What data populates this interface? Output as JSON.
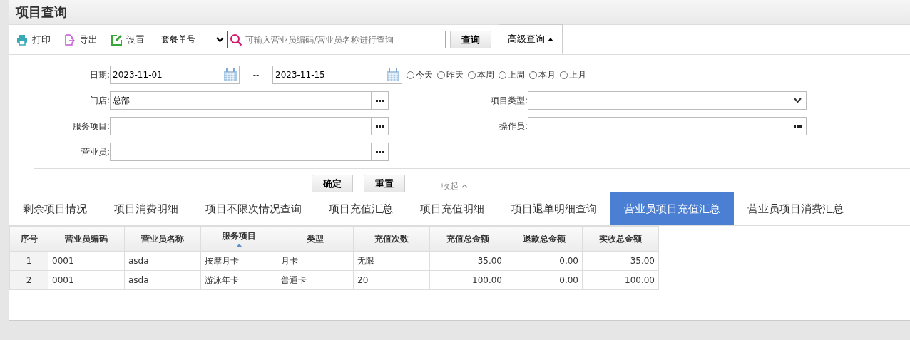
{
  "title": "项目查询",
  "toolbar": {
    "print": "打印",
    "export": "导出",
    "settings": "设置",
    "field_select": "套餐单号",
    "search_placeholder": "可输入营业员编码/营业员名称进行查询",
    "search_button": "查询",
    "advanced": "高级查询",
    "advanced_expanded": true
  },
  "form": {
    "date_label": "日期:",
    "date_from": "2023-11-01",
    "date_sep": "--",
    "date_to": "2023-11-15",
    "quick_ranges": [
      {
        "label": "今天",
        "selected": false
      },
      {
        "label": "昨天",
        "selected": false
      },
      {
        "label": "本周",
        "selected": false
      },
      {
        "label": "上周",
        "selected": false
      },
      {
        "label": "本月",
        "selected": false
      },
      {
        "label": "上月",
        "selected": false
      }
    ],
    "store_label": "门店:",
    "store_value": "总部",
    "type_label": "项目类型:",
    "service_label": "服务项目:",
    "operator_label": "操作员:",
    "salesperson_label": "营业员:",
    "confirm": "确定",
    "reset": "重置",
    "collapse": "收起"
  },
  "tabs": [
    {
      "label": "剩余项目情况",
      "selected": false
    },
    {
      "label": "项目消费明细",
      "selected": false
    },
    {
      "label": "项目不限次情况查询",
      "selected": false
    },
    {
      "label": "项目充值汇总",
      "selected": false
    },
    {
      "label": "项目充值明细",
      "selected": false
    },
    {
      "label": "项目退单明细查询",
      "selected": false
    },
    {
      "label": "营业员项目充值汇总",
      "selected": true
    },
    {
      "label": "营业员项目消费汇总",
      "selected": false
    }
  ],
  "table": {
    "columns": [
      {
        "label": "序号",
        "sorted": false
      },
      {
        "label": "营业员编码",
        "sorted": false
      },
      {
        "label": "营业员名称",
        "sorted": false
      },
      {
        "label": "服务项目",
        "sorted": true
      },
      {
        "label": "类型",
        "sorted": false
      },
      {
        "label": "充值次数",
        "sorted": false
      },
      {
        "label": "充值总金额",
        "sorted": false
      },
      {
        "label": "退款总金额",
        "sorted": false
      },
      {
        "label": "实收总金额",
        "sorted": false
      }
    ],
    "rows": [
      [
        "1",
        "0001",
        "asda",
        "按摩月卡",
        "月卡",
        "无限",
        "35.00",
        "0.00",
        "35.00"
      ],
      [
        "2",
        "0001",
        "asda",
        "游泳年卡",
        "普通卡",
        "20",
        "100.00",
        "0.00",
        "100.00"
      ]
    ]
  }
}
